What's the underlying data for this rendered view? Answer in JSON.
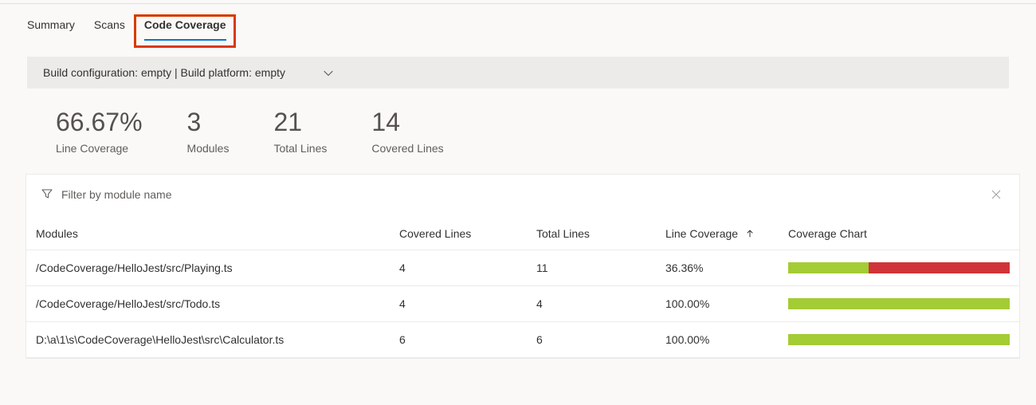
{
  "tabs": {
    "summary": "Summary",
    "scans": "Scans",
    "coverage": "Code Coverage"
  },
  "config_bar": {
    "text": "Build configuration: empty | Build platform: empty"
  },
  "metrics": {
    "line_coverage": {
      "value": "66.67%",
      "label": "Line Coverage"
    },
    "modules": {
      "value": "3",
      "label": "Modules"
    },
    "total_lines": {
      "value": "21",
      "label": "Total Lines"
    },
    "covered_lines": {
      "value": "14",
      "label": "Covered Lines"
    }
  },
  "filter": {
    "placeholder": "Filter by module name"
  },
  "columns": {
    "modules": "Modules",
    "covered": "Covered Lines",
    "total": "Total Lines",
    "coverage": "Line Coverage",
    "chart": "Coverage Chart"
  },
  "rows": [
    {
      "module": "/CodeCoverage/HelloJest/src/Playing.ts",
      "covered": "4",
      "total": "11",
      "coverage": "36.36%",
      "pct": 36.36
    },
    {
      "module": "/CodeCoverage/HelloJest/src/Todo.ts",
      "covered": "4",
      "total": "4",
      "coverage": "100.00%",
      "pct": 100
    },
    {
      "module": "D:\\a\\1\\s\\CodeCoverage\\HelloJest\\src\\Calculator.ts",
      "covered": "6",
      "total": "6",
      "coverage": "100.00%",
      "pct": 100
    }
  ],
  "colors": {
    "green": "#a4cc35",
    "red": "#d13438"
  }
}
